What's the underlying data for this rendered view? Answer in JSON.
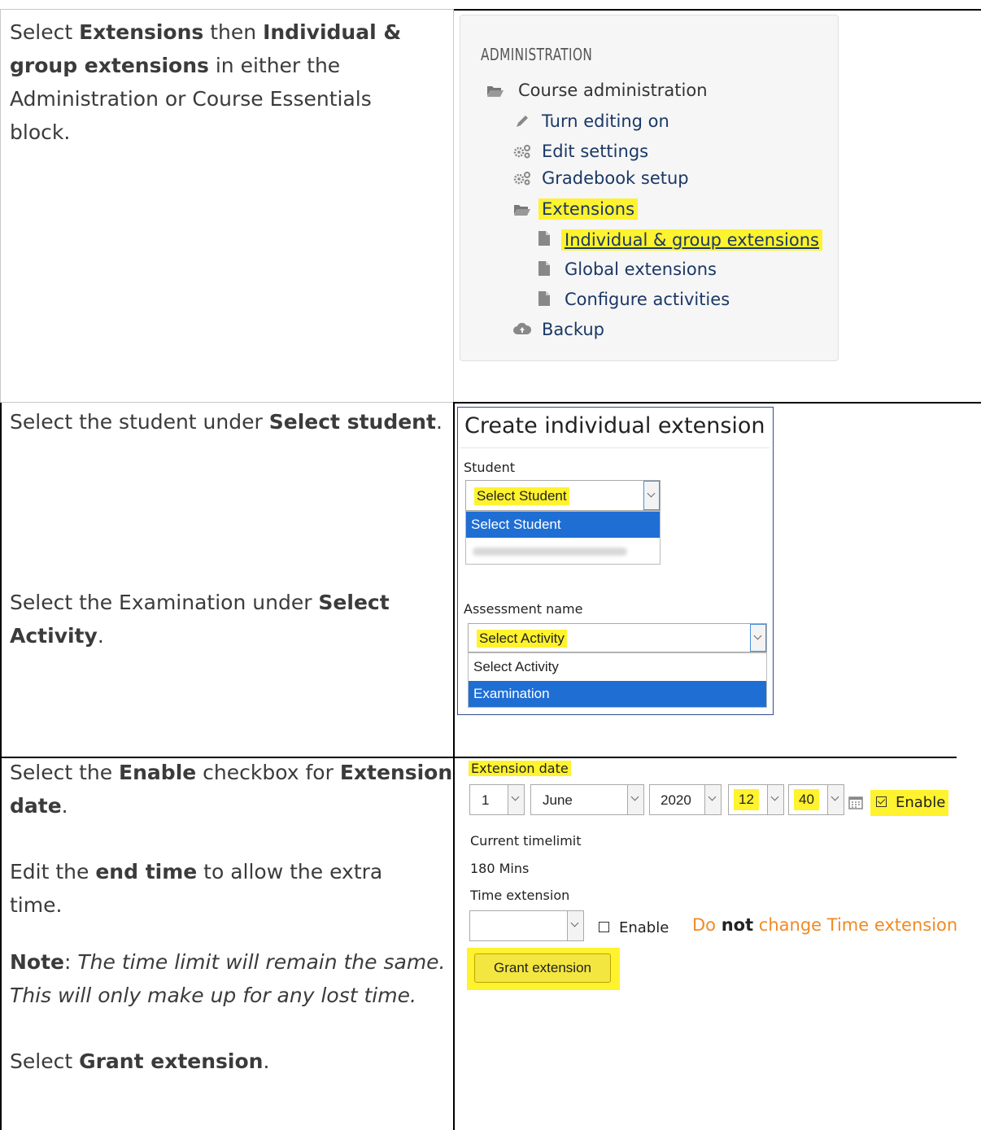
{
  "row1": {
    "instruction": {
      "p1": "Select ",
      "b1": "Extensions",
      "p2": " then ",
      "b2": "Individual & group extensions",
      "p3": " in either the Administration or Course Essentials block."
    },
    "admin": {
      "header": "ADMINISTRATION",
      "items": [
        {
          "label": "Course administration",
          "icon": "folder-open-icon"
        },
        {
          "label": "Turn editing on",
          "icon": "pencil-icon"
        },
        {
          "label": "Edit settings",
          "icon": "gears-icon"
        },
        {
          "label": "Gradebook setup",
          "icon": "gears-icon"
        },
        {
          "label": "Extensions",
          "icon": "folder-open-icon"
        },
        {
          "label": "Individual & group extensions",
          "icon": "file-icon"
        },
        {
          "label": "Global extensions",
          "icon": "file-icon"
        },
        {
          "label": "Configure activities",
          "icon": "file-icon"
        },
        {
          "label": "Backup",
          "icon": "cloud-upload-icon"
        }
      ]
    }
  },
  "row2": {
    "instruction1": {
      "p1": "Select the student under ",
      "b1": "Select student",
      "p2": "."
    },
    "instruction2": {
      "p1": "Select the Examination under ",
      "b1": "Select Activity",
      "p2": "."
    },
    "form": {
      "title": "Create individual extension",
      "student_label": "Student",
      "student_selected": "Select Student",
      "student_options": [
        "Select Student"
      ],
      "assessment_label": "Assessment name",
      "activity_selected": "Select Activity",
      "activity_options": [
        "Select Activity",
        "Examination"
      ]
    }
  },
  "row3": {
    "i1": {
      "p1": "Select the ",
      "b1": "Enable",
      "p2": " checkbox for ",
      "b2": "Extension date",
      "p3": "."
    },
    "i2": {
      "p1": "Edit the ",
      "b1": "end time",
      "p2": " to allow the extra time."
    },
    "i3": {
      "b1": "Note",
      "p1": ": ",
      "em": "The time limit will remain the same. This will only make up for any lost time."
    },
    "i4": {
      "p1": "Select ",
      "b1": "Grant extension",
      "p2": "."
    },
    "form": {
      "ext_date_label": "Extension date",
      "day": "1",
      "month": "June",
      "year": "2020",
      "hour": "12",
      "minute": "40",
      "enable_label": "Enable",
      "current_timelimit_label": "Current timelimit",
      "current_timelimit_value": "180 Mins",
      "time_extension_label": "Time extension",
      "time_enable_label": "Enable",
      "note_p1": "Do ",
      "note_b": "not",
      "note_p2": " change Time extension",
      "grant_button": "Grant extension",
      "note_color": "#f08a24",
      "highlight_color": "#fff22e"
    }
  }
}
